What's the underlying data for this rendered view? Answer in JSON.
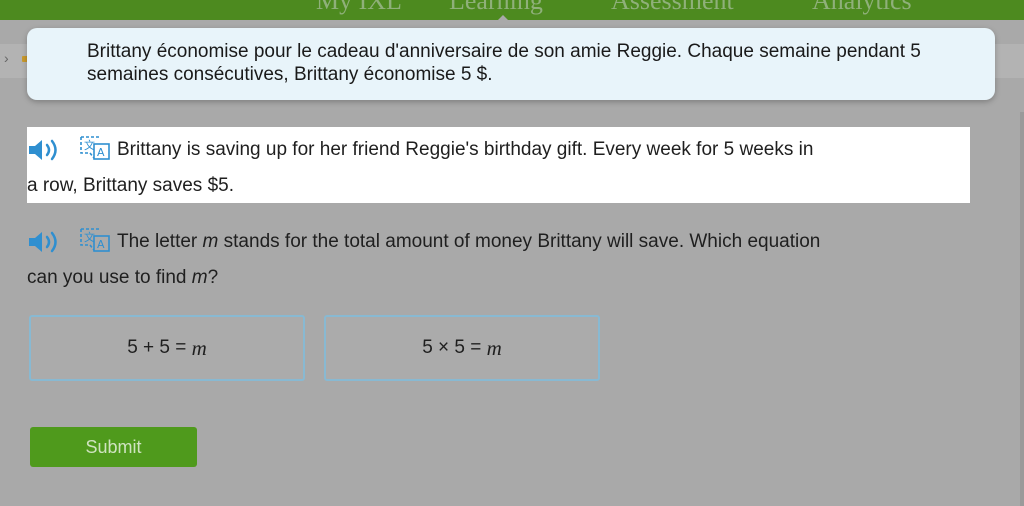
{
  "nav": {
    "items": [
      "My IXL",
      "Learning",
      "Assessment",
      "Analytics"
    ],
    "active": "Learning"
  },
  "tooltip": {
    "text": "Brittany économise pour le cadeau d'anniversaire de son amie Reggie. Chaque semaine pendant 5 semaines consécutives, Brittany économise 5 $."
  },
  "question": {
    "sentence1_line1": "Brittany is saving up for her friend Reggie's birthday gift. Every week for 5 weeks in",
    "sentence1_line2": "a row, Brittany saves $5.",
    "sentence2_line1_pre": "The letter ",
    "variable": "m",
    "sentence2_line1_post": " stands for the total amount of money Brittany will save. Which equation",
    "sentence2_line2_pre": "can you use to find ",
    "sentence2_line2_post": "?"
  },
  "answers": [
    {
      "expr": "5 + 5 = ",
      "var": "m"
    },
    {
      "expr": "5 × 5 = ",
      "var": "m"
    }
  ],
  "submit_label": "Submit",
  "icons": {
    "audio": "speaker-icon",
    "translate": "translate-icon",
    "breadcrumb": "chevron-right-icon"
  },
  "colors": {
    "nav_green": "#4d8a1f",
    "submit_green": "#4f9a1c",
    "answer_border": "#88b9d2",
    "icon_blue": "#2f8fd0",
    "tooltip_bg": "#e8f4fa"
  }
}
